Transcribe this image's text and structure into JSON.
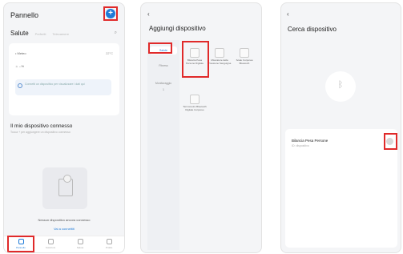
{
  "panel1": {
    "title": "Pannello",
    "add_button": "+",
    "tabs": [
      "Salute",
      "Preferiti",
      "Telecamere"
    ],
    "search_icon": "⌕",
    "weather": {
      "row1_left": "• Meteo",
      "row1_right": "22°C",
      "row2_left": "☼ --%",
      "notice": "Connetti un dispositivo per visualizzare i dati qui"
    },
    "devices_title": "Il mio dispositivo connesso",
    "devices_subtitle": "Tocca + per aggiungere un dispositivo connesso",
    "no_device_text": "Nessun dispositivo ancora connesso",
    "go_connect_link": "Vai a connettiti",
    "nav": [
      "Pannello",
      "Soluzioni",
      "Salute",
      "Profilo"
    ]
  },
  "panel2": {
    "back": "‹",
    "title": "Aggiungi dispositivo",
    "sidebar": [
      "Salute",
      "Fitness",
      "Monitoraggio"
    ],
    "sidebar_extra": "1",
    "categories": [
      "Bilancia Pesa Persone Digitale",
      "Misuratore della Pressione Sanguigna",
      "Scale Corporea Bluetooth",
      "Termometro Bluetooth Digitale Corporeo"
    ]
  },
  "panel3": {
    "back": "‹",
    "title": "Cerca dispositivo",
    "bt_symbol": "ᛒ",
    "found_device": "Bilancia Pesa Persone",
    "found_device_sub": "ID: dispositivo"
  },
  "colors": {
    "accent": "#1f7bd8",
    "highlight": "#e02a2a",
    "background": "#f4f5f7"
  }
}
